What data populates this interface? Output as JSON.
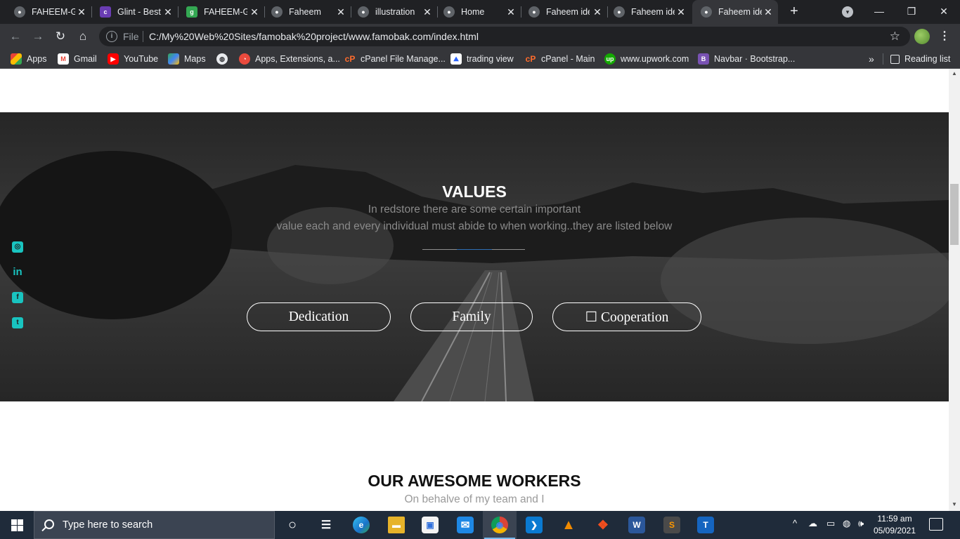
{
  "browser": {
    "tabs": [
      {
        "title": "FAHEEM-G",
        "favicon": "globe-icon",
        "color": "#5f6368"
      },
      {
        "title": "Glint - Best",
        "favicon": "colorlib-icon",
        "color": "#6a3db3"
      },
      {
        "title": "FAHEEM-G",
        "favicon": "g-icon",
        "color": "#34a853"
      },
      {
        "title": "Faheem",
        "favicon": "globe-icon",
        "color": "#5f6368"
      },
      {
        "title": "illustration",
        "favicon": "globe-icon",
        "color": "#5f6368"
      },
      {
        "title": "Home",
        "favicon": "globe-icon",
        "color": "#5f6368"
      },
      {
        "title": "Faheem ide",
        "favicon": "globe-icon",
        "color": "#5f6368"
      },
      {
        "title": "Faheem ide",
        "favicon": "globe-icon",
        "color": "#5f6368"
      },
      {
        "title": "Faheem ide",
        "favicon": "globe-icon",
        "color": "#5f6368",
        "active": true
      }
    ],
    "new_tab": "+",
    "omnibox": {
      "scheme_label": "File",
      "url": "C:/My%20Web%20Sites/famobak%20project/www.famobak.com/index.html"
    },
    "bookmarks": [
      {
        "label": "Apps",
        "icon": "apps-grid-icon",
        "color": "#ea4335"
      },
      {
        "label": "Gmail",
        "icon": "gmail-icon",
        "color": "#ea4335"
      },
      {
        "label": "YouTube",
        "icon": "youtube-icon",
        "color": "#ff0000"
      },
      {
        "label": "Maps",
        "icon": "maps-icon",
        "color": "#34a853"
      },
      {
        "label": "",
        "icon": "globe-icon",
        "color": "#5f6368"
      },
      {
        "label": "Apps, Extensions, a...",
        "icon": "extensions-icon",
        "color": "#e94a3d"
      },
      {
        "label": "cPanel File Manage...",
        "icon": "cpanel-icon",
        "color": "#ff6c2c"
      },
      {
        "label": "trading view",
        "icon": "tradingview-icon",
        "color": "#2962ff"
      },
      {
        "label": "cPanel - Main",
        "icon": "cpanel-icon",
        "color": "#ff6c2c"
      },
      {
        "label": "www.upwork.com",
        "icon": "upwork-icon",
        "color": "#14a800"
      },
      {
        "label": "Navbar · Bootstrap...",
        "icon": "bootstrap-icon",
        "color": "#7952b3"
      }
    ],
    "more_bookmarks": "»",
    "reading_list": "Reading list"
  },
  "page": {
    "values": {
      "title": "VALUES",
      "subtitle_line1": "In redstore there are some certain important",
      "subtitle_line2": "value each and every individual must abide to when working..they are listed below",
      "pills": [
        {
          "label": "Dedication"
        },
        {
          "label": "Family"
        },
        {
          "label": "☐ Cooperation"
        }
      ]
    },
    "social": [
      {
        "icon": "instagram-icon",
        "glyph": "◎"
      },
      {
        "icon": "linkedin-icon",
        "glyph": "in"
      },
      {
        "icon": "facebook-icon",
        "glyph": "f"
      },
      {
        "icon": "twitter-icon",
        "glyph": "t"
      }
    ],
    "workers": {
      "title": "OUR AWESOME WORKERS",
      "subtitle": "On behalve of my team and I"
    },
    "accent_color": "#19c4c0"
  },
  "taskbar": {
    "search_placeholder": "Type here to search",
    "apps": [
      {
        "name": "cortana-icon",
        "color": "transparent",
        "glyph": "○"
      },
      {
        "name": "task-view-icon",
        "color": "transparent",
        "glyph": "☰"
      },
      {
        "name": "edge-icon",
        "color": "#1a73c9",
        "glyph": "e"
      },
      {
        "name": "file-explorer-icon",
        "color": "#e6b32a",
        "glyph": "▬"
      },
      {
        "name": "microsoft-store-icon",
        "color": "#2f6fdb",
        "glyph": "▣"
      },
      {
        "name": "mail-icon",
        "color": "#1e88e5",
        "glyph": "✉"
      },
      {
        "name": "chrome-icon",
        "color": "#db4437",
        "glyph": "◉",
        "active": true
      },
      {
        "name": "vscode-icon",
        "color": "#0a7ad1",
        "glyph": "❯"
      },
      {
        "name": "vlc-icon",
        "color": "#f08a00",
        "glyph": "▲"
      },
      {
        "name": "figma-icon",
        "color": "#a259ff",
        "glyph": "❖"
      },
      {
        "name": "word-icon",
        "color": "#2b579a",
        "glyph": "W"
      },
      {
        "name": "sublime-text-icon",
        "color": "#ff9800",
        "glyph": "S"
      },
      {
        "name": "typora-icon",
        "color": "#1565c0",
        "glyph": "T"
      }
    ],
    "tray": {
      "chevron": "^",
      "time": "11:59 am",
      "date": "05/09/2021"
    }
  }
}
